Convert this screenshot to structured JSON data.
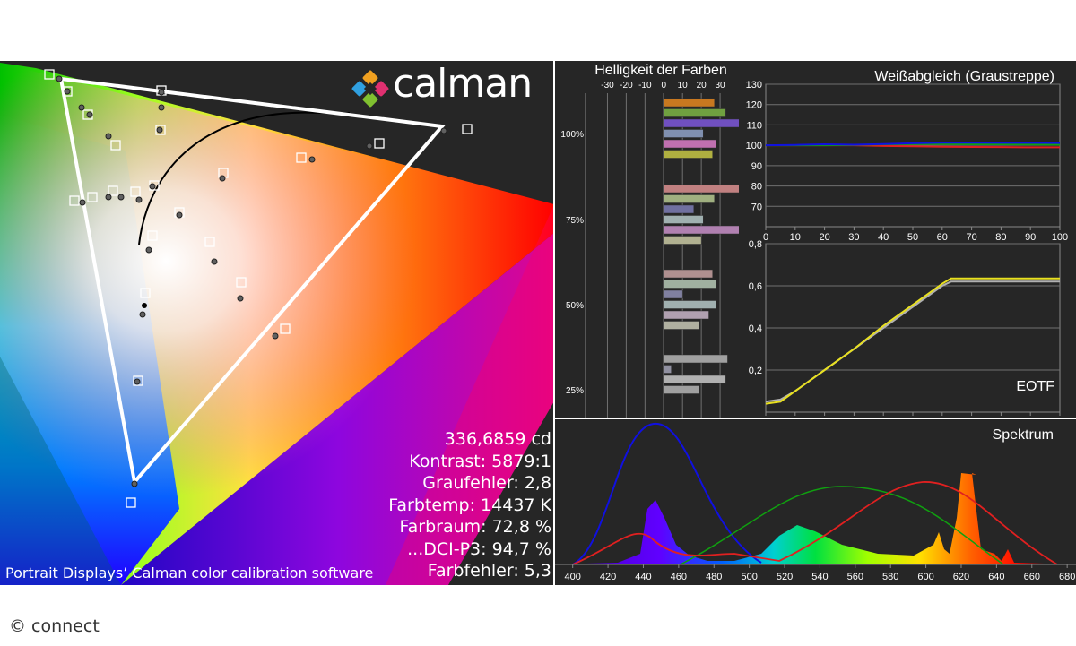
{
  "logo": {
    "text": "calman"
  },
  "caption": "Portrait Displays’ Calman color calibration software",
  "credit": "© connect",
  "stats": {
    "luminance": "336,6859 cd",
    "contrast": "Kontrast: 5879:1",
    "gray_error": "Graufehler: 2,8",
    "color_temp": "Farbtemp: 14437 K",
    "gamut": "Farbraum: 72,8 %",
    "dci_p3": "...DCI-P3: 94,7 %",
    "color_error": "Farbfehler: 5,3"
  },
  "colors": {
    "background": "#262626",
    "white": "#ffffff",
    "yellow": "#e8e020",
    "red": "#e02020",
    "green": "#10a010",
    "blue": "#1010e0"
  },
  "chart_data": [
    {
      "type": "scatter",
      "name": "cie-gamut",
      "triangle": [
        [
          0.065,
          0.01
        ],
        [
          0.18,
          0.0
        ],
        [
          0.92,
          0.14
        ],
        [
          0.3,
          0.6
        ],
        [
          0.15,
          0.9
        ]
      ]
    },
    {
      "type": "bar",
      "title": "Helligkeit der Farben",
      "xticks": [
        "-30",
        "-20",
        "-10",
        "0",
        "10",
        "20",
        "30"
      ],
      "xlim": [
        -35,
        40
      ],
      "yticks": [
        "100%",
        "75%",
        "50%",
        "25%"
      ],
      "groups": [
        {
          "level": "100%",
          "values": [
            27,
            33,
            41,
            21,
            28,
            26
          ],
          "colors": [
            "#c87820",
            "#70a040",
            "#7050c0",
            "#8090b0",
            "#c070b0",
            "#b0b040"
          ]
        },
        {
          "level": "75%",
          "values": [
            42,
            27,
            16,
            21,
            43,
            20
          ],
          "colors": [
            "#c08080",
            "#a0b080",
            "#7070a0",
            "#a0b0b0",
            "#b080b0",
            "#b0b090"
          ]
        },
        {
          "level": "50%",
          "values": [
            26,
            28,
            10,
            28,
            24,
            19
          ],
          "colors": [
            "#b09090",
            "#a0b0a0",
            "#8080a0",
            "#a0b0b0",
            "#b0a0b0",
            "#b0b0a0"
          ]
        },
        {
          "level": "25%",
          "values": [
            34,
            4,
            33,
            19
          ],
          "colors": [
            "#a0a0a0",
            "#9090a0",
            "#b0b0b0",
            "#a0a0a0"
          ]
        }
      ]
    },
    {
      "type": "line",
      "title": "Weißabgleich (Graustreppe)",
      "x": [
        0,
        10,
        20,
        30,
        40,
        50,
        60,
        70,
        80,
        90,
        100
      ],
      "xlim": [
        0,
        100
      ],
      "ylim": [
        60,
        130
      ],
      "yticks": [
        "70",
        "80",
        "90",
        "100",
        "110",
        "120",
        "130"
      ],
      "xticks": [
        "0",
        "10",
        "20",
        "30",
        "40",
        "50",
        "60",
        "70",
        "80",
        "90",
        "100"
      ],
      "series": [
        {
          "color": "#e02020",
          "values": [
            100,
            100,
            100,
            100,
            99.7,
            99.5,
            99.3,
            99.2,
            99.1,
            99,
            99
          ]
        },
        {
          "color": "#10a010",
          "values": [
            100,
            100,
            100,
            100.2,
            100.5,
            100.6,
            100.6,
            100.5,
            100.5,
            100.4,
            100.3
          ]
        },
        {
          "color": "#1010e0",
          "values": [
            100,
            100.2,
            100.5,
            100.3,
            100.6,
            101,
            101.3,
            101.3,
            101.2,
            101.2,
            101.1
          ]
        }
      ]
    },
    {
      "type": "line",
      "title": "EOTF",
      "x": [
        0,
        5,
        10,
        20,
        30,
        40,
        50,
        60,
        63,
        70,
        80,
        90,
        100
      ],
      "xlim": [
        0,
        100
      ],
      "ylim": [
        0,
        0.8
      ],
      "yticks": [
        "0,2",
        "0,4",
        "0,6",
        "0,8"
      ],
      "xticks": [
        "0",
        "10",
        "20",
        "30",
        "40",
        "50",
        "60",
        "70",
        "80",
        "90",
        "100"
      ],
      "series": [
        {
          "color": "#b0b0b0",
          "values": [
            0.05,
            0.06,
            0.1,
            0.2,
            0.3,
            0.4,
            0.5,
            0.6,
            0.62,
            0.62,
            0.62,
            0.62,
            0.62
          ]
        },
        {
          "color": "#e8e020",
          "values": [
            0.04,
            0.05,
            0.1,
            0.2,
            0.3,
            0.41,
            0.51,
            0.61,
            0.635,
            0.635,
            0.635,
            0.635,
            0.635
          ]
        }
      ]
    },
    {
      "type": "area",
      "title": "Spektrum",
      "xlim": [
        390,
        685
      ],
      "xticks": [
        "400",
        "420",
        "440",
        "460",
        "480",
        "500",
        "520",
        "540",
        "560",
        "580",
        "600",
        "620",
        "640",
        "660",
        "680"
      ]
    }
  ]
}
